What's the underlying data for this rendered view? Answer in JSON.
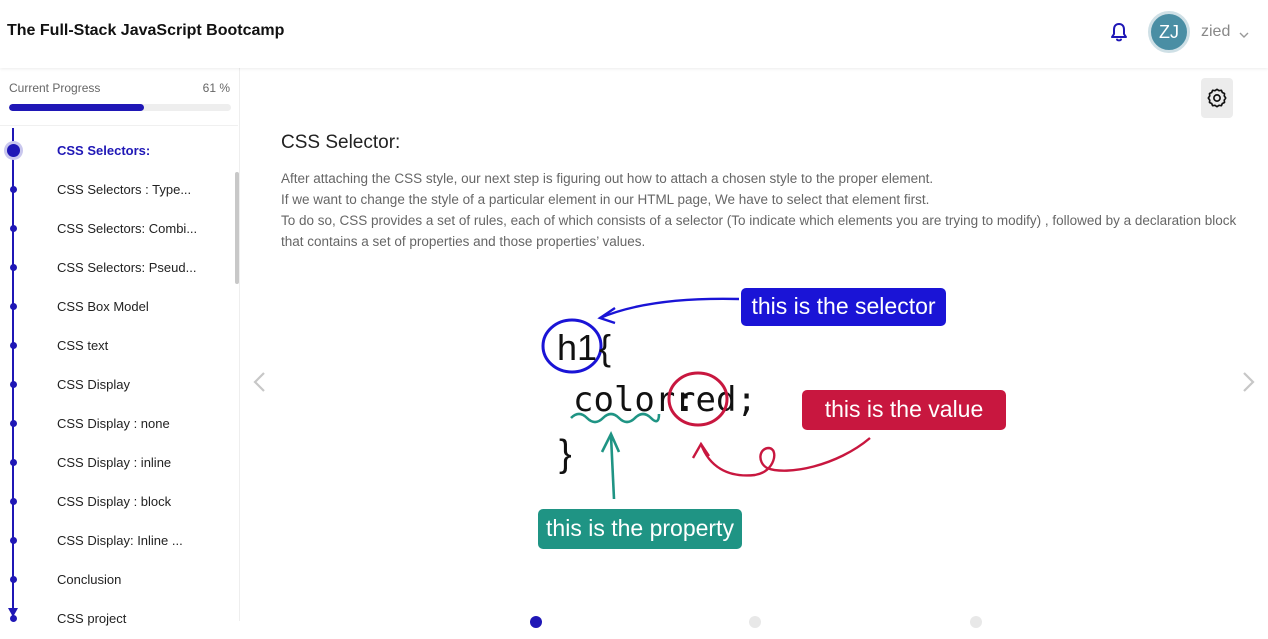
{
  "header": {
    "course_title": "The Full-Stack JavaScript Bootcamp",
    "user_initials": "ZJ",
    "username": "zied",
    "bell_icon": "bell-icon",
    "accent_color": "#1f17b6"
  },
  "sidebar": {
    "progress_label": "Current Progress",
    "progress_percent_text": "61 %",
    "progress_value": 0.61,
    "lessons": [
      {
        "label": "CSS Selectors:",
        "active": true
      },
      {
        "label": "CSS Selectors : Type..."
      },
      {
        "label": "CSS Selectors: Combi..."
      },
      {
        "label": "CSS Selectors: Pseud..."
      },
      {
        "label": "CSS Box Model"
      },
      {
        "label": "CSS text"
      },
      {
        "label": "CSS Display"
      },
      {
        "label": "CSS Display : none"
      },
      {
        "label": "CSS Display : inline"
      },
      {
        "label": "CSS Display : block"
      },
      {
        "label": "CSS Display: Inline ..."
      },
      {
        "label": "Conclusion"
      },
      {
        "label": "CSS project"
      }
    ]
  },
  "main": {
    "title": "CSS Selector:",
    "paragraphs": [
      "After attaching the CSS style, our next step is figuring out how to attach a chosen style to the proper element.",
      "If we want to change the style of a particular element in our HTML page, We have to select that element first.",
      "To do so, CSS provides a set of rules, each of which consists of a selector (To indicate which elements you are trying to modify) , followed by a declaration block that contains a set of properties and those properties’ values."
    ],
    "diagram": {
      "code_selector": "h1",
      "code_open_brace": "{",
      "code_property": "color:",
      "code_value": "red;",
      "code_close_brace": "}",
      "selector_label": "this is the selector",
      "value_label": "this is the value",
      "property_label": "this is the property",
      "selector_color": "#1a14d6",
      "value_color": "#c8173f",
      "property_color": "#1f9484"
    }
  }
}
